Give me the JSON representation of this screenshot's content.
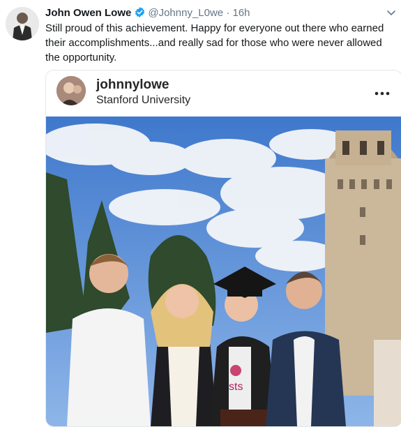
{
  "tweet": {
    "author_name": "John Owen Lowe",
    "handle": "@Johnny_L0we",
    "separator": "·",
    "time": "16h",
    "text": "Still proud of this achievement. Happy for everyone out there who earned their accomplishments...and really sad for those who were never allowed the opportunity."
  },
  "embed": {
    "username": "johnnylowe",
    "location": "Stanford University",
    "stole_text": "sts"
  },
  "colors": {
    "verified": "#1da1f2",
    "sky": "#4f86d6",
    "tower": "#cbb79a"
  }
}
